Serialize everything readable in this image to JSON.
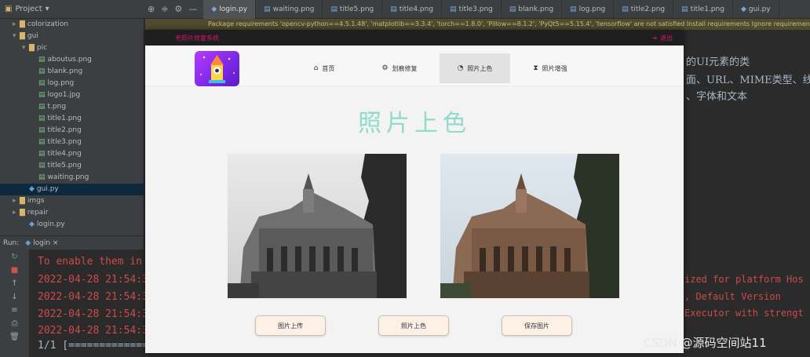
{
  "ide": {
    "project_label": "Project",
    "tools": [
      "⊕",
      "≑",
      "⚙",
      "—"
    ],
    "tabs": [
      "login.py",
      "waiting.png",
      "title5.png",
      "title4.png",
      "title3.png",
      "blank.png",
      "log.png",
      "title2.png",
      "title1.png",
      "gui.py"
    ],
    "banner": "Package requirements 'opencv-python==4.5.1.48', 'matplotlib==3.3.4', 'torch==1.8.0', 'Pillow==8.1.2', 'PyQt5==5.15.4', 'tensorflow' are not satisfied      Install requirements      Ignore requirements"
  },
  "tree": [
    {
      "indent": 1,
      "arrow": "▸",
      "kind": "fold",
      "label": "colorization"
    },
    {
      "indent": 1,
      "arrow": "▾",
      "kind": "fold",
      "label": "gui"
    },
    {
      "indent": 2,
      "arrow": "▾",
      "kind": "fold",
      "label": "pic"
    },
    {
      "indent": 3,
      "arrow": "",
      "kind": "file",
      "label": "aboutus.png"
    },
    {
      "indent": 3,
      "arrow": "",
      "kind": "file",
      "label": "blank.png"
    },
    {
      "indent": 3,
      "arrow": "",
      "kind": "file",
      "label": "log.png"
    },
    {
      "indent": 3,
      "arrow": "",
      "kind": "file",
      "label": "logo1.jpg"
    },
    {
      "indent": 3,
      "arrow": "",
      "kind": "file",
      "label": "t.png"
    },
    {
      "indent": 3,
      "arrow": "",
      "kind": "file",
      "label": "title1.png"
    },
    {
      "indent": 3,
      "arrow": "",
      "kind": "file",
      "label": "title2.png"
    },
    {
      "indent": 3,
      "arrow": "",
      "kind": "file",
      "label": "title3.png"
    },
    {
      "indent": 3,
      "arrow": "",
      "kind": "file",
      "label": "title4.png"
    },
    {
      "indent": 3,
      "arrow": "",
      "kind": "file",
      "label": "title5.png"
    },
    {
      "indent": 3,
      "arrow": "",
      "kind": "file",
      "label": "waiting.png"
    },
    {
      "indent": 2,
      "arrow": "",
      "kind": "py",
      "label": "gui.py",
      "selected": true
    },
    {
      "indent": 1,
      "arrow": "▸",
      "kind": "fold",
      "label": "imgs"
    },
    {
      "indent": 1,
      "arrow": "▸",
      "kind": "fold",
      "label": "repair"
    },
    {
      "indent": 2,
      "arrow": "",
      "kind": "py",
      "label": "login.py"
    }
  ],
  "run": {
    "header_label": "Run:",
    "run_tab": "login",
    "lines": [
      "To enable them in",
      "2022-04-28 21:54:3",
      "2022-04-28 21:54:3",
      "2022-04-28 21:54:3",
      "2022-04-28 21:54:3"
    ],
    "progress_line": "1/1 [=============",
    "right_lines": [
      "ized for platform Hos",
      ", Default Version",
      "Executor with strengt"
    ]
  },
  "editor_right": [
    "的UI元素的类",
    "面、URL、MIME类型、线",
    "、字体和文本"
  ],
  "app": {
    "title": "老照片修复系统",
    "exit_label": "退出",
    "nav": [
      {
        "icon": "⌂",
        "label": "首页",
        "active": false
      },
      {
        "icon": "⚙",
        "label": "划痕修复",
        "active": false
      },
      {
        "icon": "◔",
        "label": "照片上色",
        "active": true
      },
      {
        "icon": "⧗",
        "label": "照片增强",
        "active": false
      }
    ],
    "heading": "照片上色",
    "buttons": [
      "图片上传",
      "照片上色",
      "保存图片"
    ]
  },
  "watermark": "CSDN @源码空间站11"
}
